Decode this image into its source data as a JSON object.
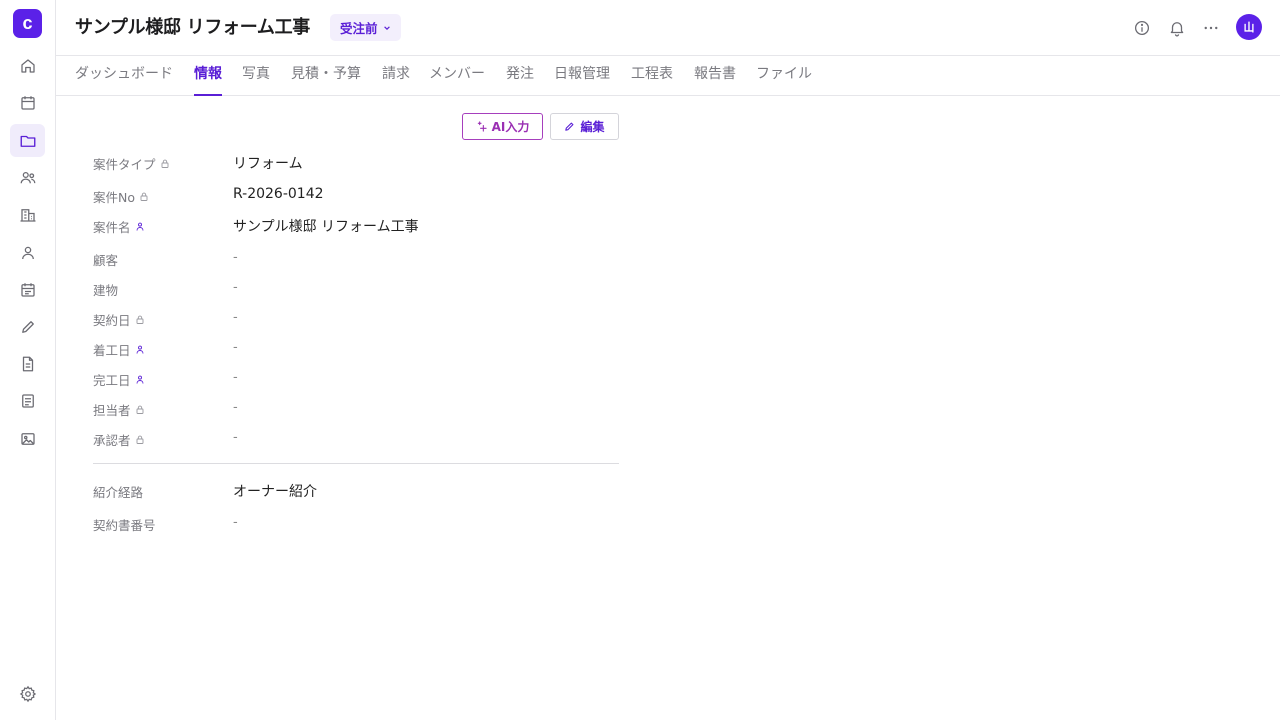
{
  "app": {
    "logo_letter": "c"
  },
  "header": {
    "title": "サンプル様邸 リフォーム工事",
    "status": "受注前",
    "avatar_initial": "山"
  },
  "tabs": [
    {
      "label": "ダッシュボード",
      "active": false
    },
    {
      "label": "情報",
      "active": true
    },
    {
      "label": "写真",
      "active": false
    },
    {
      "label": "見積・予算",
      "active": false
    },
    {
      "label": "請求",
      "active": false
    },
    {
      "label": "メンバー",
      "active": false
    },
    {
      "label": "発注",
      "active": false
    },
    {
      "label": "日報管理",
      "active": false
    },
    {
      "label": "工程表",
      "active": false
    },
    {
      "label": "報告書",
      "active": false
    },
    {
      "label": "ファイル",
      "active": false
    }
  ],
  "actions": {
    "ai_label": "AI入力",
    "edit_label": "編集"
  },
  "fields": [
    {
      "label": "案件タイプ",
      "icon": "lock-icon",
      "value": "リフォーム"
    },
    {
      "label": "案件No",
      "icon": "lock-icon",
      "value": "R-2026-0142"
    },
    {
      "label": "案件名",
      "icon": "person-icon",
      "value": "サンプル様邸 リフォーム工事"
    },
    {
      "label": "顧客",
      "icon": "",
      "value": "-"
    },
    {
      "label": "建物",
      "icon": "",
      "value": "-"
    },
    {
      "label": "契約日",
      "icon": "lock-icon",
      "value": "-"
    },
    {
      "label": "着工日",
      "icon": "person-icon",
      "value": "-"
    },
    {
      "label": "完工日",
      "icon": "person-icon",
      "value": "-"
    },
    {
      "label": "担当者",
      "icon": "lock-icon",
      "value": "-"
    },
    {
      "label": "承認者",
      "icon": "lock-icon",
      "value": "-"
    }
  ],
  "extra_fields": [
    {
      "label": "紹介経路",
      "value": "オーナー紹介"
    },
    {
      "label": "契約書番号",
      "value": "-"
    }
  ],
  "colors": {
    "brand": "#5b21e8",
    "accent": "#5a1fd6",
    "ai": "#9a2fb3"
  }
}
